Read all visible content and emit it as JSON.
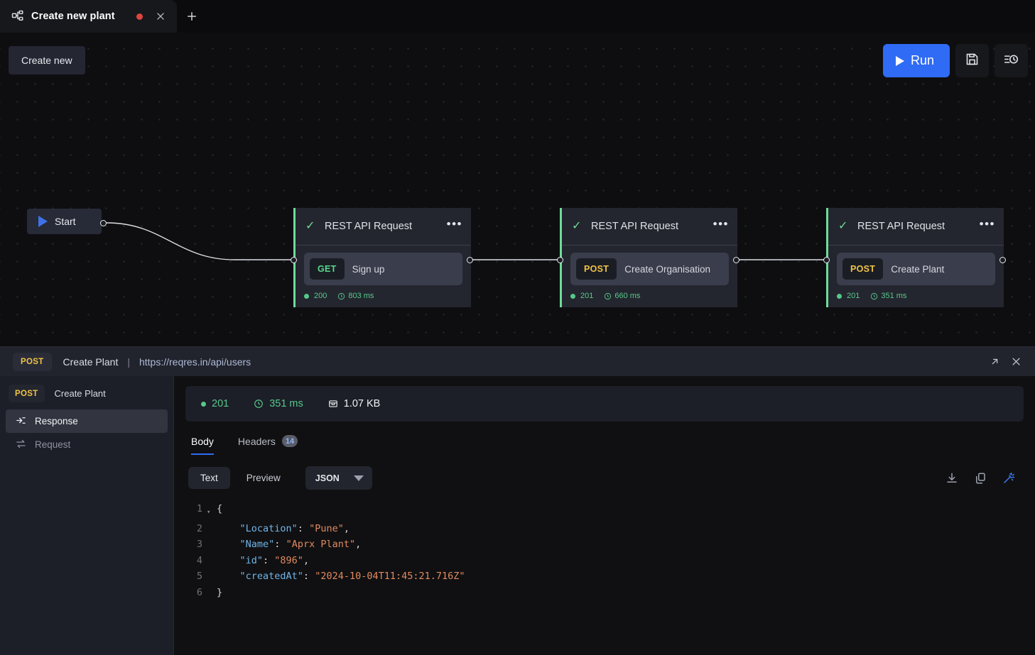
{
  "tab": {
    "title": "Create new plant",
    "icon": "workflow-icon",
    "dirty": true,
    "close_label": "×",
    "new_tab_label": "+"
  },
  "toolbar": {
    "create_new_label": "Create new",
    "run_label": "Run",
    "save_icon": "floppy-disk-icon",
    "history_icon": "history-clock-icon"
  },
  "canvas": {
    "start": {
      "label": "Start",
      "icon": "play-triangle-icon"
    },
    "nodes": [
      {
        "title": "REST API Request",
        "status_icon": "check-icon",
        "menu_icon": "more-dots-icon",
        "method": "GET",
        "method_class": "get",
        "name": "Sign up",
        "status_code": "200",
        "duration": "803 ms"
      },
      {
        "title": "REST API Request",
        "status_icon": "check-icon",
        "menu_icon": "more-dots-icon",
        "method": "POST",
        "method_class": "post",
        "name": "Create Organisation",
        "status_code": "201",
        "duration": "660 ms"
      },
      {
        "title": "REST API Request",
        "status_icon": "check-icon",
        "menu_icon": "more-dots-icon",
        "method": "POST",
        "method_class": "post",
        "name": "Create Plant",
        "status_code": "201",
        "duration": "351 ms"
      }
    ]
  },
  "panel": {
    "header": {
      "method": "POST",
      "name": "Create Plant",
      "separator": "|",
      "url": "https://reqres.in/api/users",
      "expand_icon": "expand-arrow-icon",
      "close_icon": "close-icon"
    },
    "sidebar": {
      "method": "POST",
      "name": "Create Plant",
      "items": [
        {
          "label": "Response",
          "icon": "response-arrow-icon",
          "active": true
        },
        {
          "label": "Request",
          "icon": "request-arrows-icon",
          "active": false
        }
      ]
    },
    "status": {
      "code": "201",
      "duration": "351 ms",
      "size": "1.07 KB"
    },
    "tabs": [
      {
        "label": "Body",
        "badge": null,
        "active": true
      },
      {
        "label": "Headers",
        "badge": "14",
        "active": false
      }
    ],
    "format": {
      "text_label": "Text",
      "preview_label": "Preview",
      "selected_type": "JSON",
      "download_icon": "download-icon",
      "copy_icon": "copy-icon",
      "beautify_icon": "magic-wand-icon"
    },
    "code": {
      "lines": [
        {
          "n": "1",
          "fold": "▾",
          "parts": [
            {
              "t": "{",
              "c": "p"
            }
          ]
        },
        {
          "n": "2",
          "fold": "",
          "parts": [
            {
              "t": "    ",
              "c": "p"
            },
            {
              "t": "\"Location\"",
              "c": "k"
            },
            {
              "t": ": ",
              "c": "p"
            },
            {
              "t": "\"Pune\"",
              "c": "s"
            },
            {
              "t": ",",
              "c": "p"
            }
          ]
        },
        {
          "n": "3",
          "fold": "",
          "parts": [
            {
              "t": "    ",
              "c": "p"
            },
            {
              "t": "\"Name\"",
              "c": "k"
            },
            {
              "t": ": ",
              "c": "p"
            },
            {
              "t": "\"Aprx Plant\"",
              "c": "s"
            },
            {
              "t": ",",
              "c": "p"
            }
          ]
        },
        {
          "n": "4",
          "fold": "",
          "parts": [
            {
              "t": "    ",
              "c": "p"
            },
            {
              "t": "\"id\"",
              "c": "k"
            },
            {
              "t": ": ",
              "c": "p"
            },
            {
              "t": "\"896\"",
              "c": "s"
            },
            {
              "t": ",",
              "c": "p"
            }
          ]
        },
        {
          "n": "5",
          "fold": "",
          "parts": [
            {
              "t": "    ",
              "c": "p"
            },
            {
              "t": "\"createdAt\"",
              "c": "k"
            },
            {
              "t": ": ",
              "c": "p"
            },
            {
              "t": "\"2024-10-04T11:45:21.716Z\"",
              "c": "s"
            }
          ]
        },
        {
          "n": "6",
          "fold": "",
          "parts": [
            {
              "t": "}",
              "c": "p"
            }
          ]
        }
      ]
    }
  },
  "colors": {
    "accent_blue": "#2f6bf4",
    "success_green": "#56c98a",
    "post_yellow": "#f0c445",
    "get_green": "#55d98a",
    "node_border": "#6fdc9a",
    "dirty_red": "#e0443e"
  }
}
